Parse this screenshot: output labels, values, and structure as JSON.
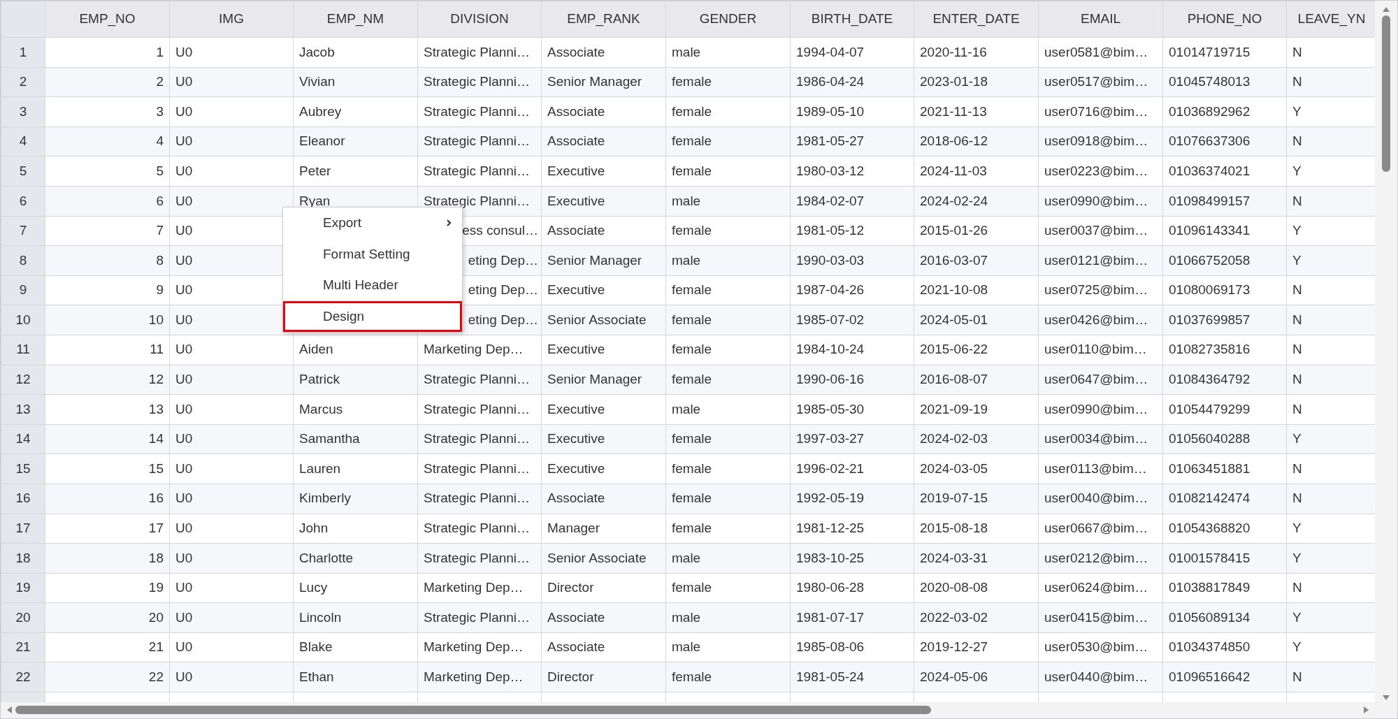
{
  "grid": {
    "columns": [
      "EMP_NO",
      "IMG",
      "EMP_NM",
      "DIVISION",
      "EMP_RANK",
      "GENDER",
      "BIRTH_DATE",
      "ENTER_DATE",
      "EMAIL",
      "PHONE_NO",
      "LEAVE_YN"
    ],
    "rows": [
      {
        "row_no": "1",
        "cells": [
          "1",
          "U0",
          "Jacob",
          "Strategic Planni…",
          "Associate",
          "male",
          "1994-04-07",
          "2020-11-16",
          "user0581@bim…",
          "01014719715",
          "N"
        ]
      },
      {
        "row_no": "2",
        "cells": [
          "2",
          "U0",
          "Vivian",
          "Strategic Planni…",
          "Senior Manager",
          "female",
          "1986-04-24",
          "2023-01-18",
          "user0517@bim…",
          "01045748013",
          "N"
        ]
      },
      {
        "row_no": "3",
        "cells": [
          "3",
          "U0",
          "Aubrey",
          "Strategic Planni…",
          "Associate",
          "female",
          "1989-05-10",
          "2021-11-13",
          "user0716@bim…",
          "01036892962",
          "Y"
        ]
      },
      {
        "row_no": "4",
        "cells": [
          "4",
          "U0",
          "Eleanor",
          "Strategic Planni…",
          "Associate",
          "female",
          "1981-05-27",
          "2018-06-12",
          "user0918@bim…",
          "01076637306",
          "N"
        ]
      },
      {
        "row_no": "5",
        "cells": [
          "5",
          "U0",
          "Peter",
          "Strategic Planni…",
          "Executive",
          "female",
          "1980-03-12",
          "2024-11-03",
          "user0223@bim…",
          "01036374021",
          "Y"
        ]
      },
      {
        "row_no": "6",
        "cells": [
          "6",
          "U0",
          "Ryan",
          "Strategic Planni…",
          "Executive",
          "male",
          "1984-02-07",
          "2024-02-24",
          "user0990@bim…",
          "01098499157",
          "N"
        ]
      },
      {
        "row_no": "7",
        "covered": true,
        "cells": [
          "7",
          "U0",
          "ess consul…",
          "Associate",
          "female",
          "1981-05-12",
          "2015-01-26",
          "user0037@bim…",
          "01096143341",
          "Y"
        ]
      },
      {
        "row_no": "8",
        "covered": true,
        "cells": [
          "8",
          "U0",
          "eting Dep…",
          "Senior Manager",
          "male",
          "1990-03-03",
          "2016-03-07",
          "user0121@bim…",
          "01066752058",
          "Y"
        ]
      },
      {
        "row_no": "9",
        "covered": true,
        "cells": [
          "9",
          "U0",
          "eting Dep…",
          "Executive",
          "female",
          "1987-04-26",
          "2021-10-08",
          "user0725@bim…",
          "01080069173",
          "N"
        ]
      },
      {
        "row_no": "10",
        "covered": true,
        "cells": [
          "10",
          "U0",
          "eting Dep…",
          "Senior Associate",
          "female",
          "1985-07-02",
          "2024-05-01",
          "user0426@bim…",
          "01037699857",
          "N"
        ]
      },
      {
        "row_no": "11",
        "cells": [
          "11",
          "U0",
          "Aiden",
          "Marketing Dep…",
          "Executive",
          "female",
          "1984-10-24",
          "2015-06-22",
          "user0110@bim…",
          "01082735816",
          "N"
        ]
      },
      {
        "row_no": "12",
        "cells": [
          "12",
          "U0",
          "Patrick",
          "Strategic Planni…",
          "Senior Manager",
          "female",
          "1990-06-16",
          "2016-08-07",
          "user0647@bim…",
          "01084364792",
          "N"
        ]
      },
      {
        "row_no": "13",
        "cells": [
          "13",
          "U0",
          "Marcus",
          "Strategic Planni…",
          "Executive",
          "male",
          "1985-05-30",
          "2021-09-19",
          "user0990@bim…",
          "01054479299",
          "N"
        ]
      },
      {
        "row_no": "14",
        "cells": [
          "14",
          "U0",
          "Samantha",
          "Strategic Planni…",
          "Executive",
          "female",
          "1997-03-27",
          "2024-02-03",
          "user0034@bim…",
          "01056040288",
          "Y"
        ]
      },
      {
        "row_no": "15",
        "cells": [
          "15",
          "U0",
          "Lauren",
          "Strategic Planni…",
          "Executive",
          "female",
          "1996-02-21",
          "2024-03-05",
          "user0113@bim…",
          "01063451881",
          "N"
        ]
      },
      {
        "row_no": "16",
        "cells": [
          "16",
          "U0",
          "Kimberly",
          "Strategic Planni…",
          "Associate",
          "female",
          "1992-05-19",
          "2019-07-15",
          "user0040@bim…",
          "01082142474",
          "N"
        ]
      },
      {
        "row_no": "17",
        "cells": [
          "17",
          "U0",
          "John",
          "Strategic Planni…",
          "Manager",
          "female",
          "1981-12-25",
          "2015-08-18",
          "user0667@bim…",
          "01054368820",
          "Y"
        ]
      },
      {
        "row_no": "18",
        "cells": [
          "18",
          "U0",
          "Charlotte",
          "Strategic Planni…",
          "Senior Associate",
          "male",
          "1983-10-25",
          "2024-03-31",
          "user0212@bim…",
          "01001578415",
          "Y"
        ]
      },
      {
        "row_no": "19",
        "cells": [
          "19",
          "U0",
          "Lucy",
          "Marketing Dep…",
          "Director",
          "female",
          "1980-06-28",
          "2020-08-08",
          "user0624@bim…",
          "01038817849",
          "N"
        ]
      },
      {
        "row_no": "20",
        "cells": [
          "20",
          "U0",
          "Lincoln",
          "Strategic Planni…",
          "Associate",
          "male",
          "1981-07-17",
          "2022-03-02",
          "user0415@bim…",
          "01056089134",
          "Y"
        ]
      },
      {
        "row_no": "21",
        "cells": [
          "21",
          "U0",
          "Blake",
          "Marketing Dep…",
          "Associate",
          "male",
          "1985-08-06",
          "2019-12-27",
          "user0530@bim…",
          "01034374850",
          "Y"
        ]
      },
      {
        "row_no": "22",
        "cells": [
          "22",
          "U0",
          "Ethan",
          "Marketing Dep…",
          "Director",
          "female",
          "1981-05-24",
          "2024-05-06",
          "user0440@bim…",
          "01096516642",
          "N"
        ]
      }
    ]
  },
  "context_menu": {
    "items": [
      {
        "label": "Export",
        "submenu": true,
        "selected": false
      },
      {
        "label": "Format Setting",
        "submenu": false,
        "selected": false
      },
      {
        "label": "Multi Header",
        "submenu": false,
        "selected": false
      },
      {
        "label": "Design",
        "submenu": false,
        "selected": true
      }
    ]
  }
}
